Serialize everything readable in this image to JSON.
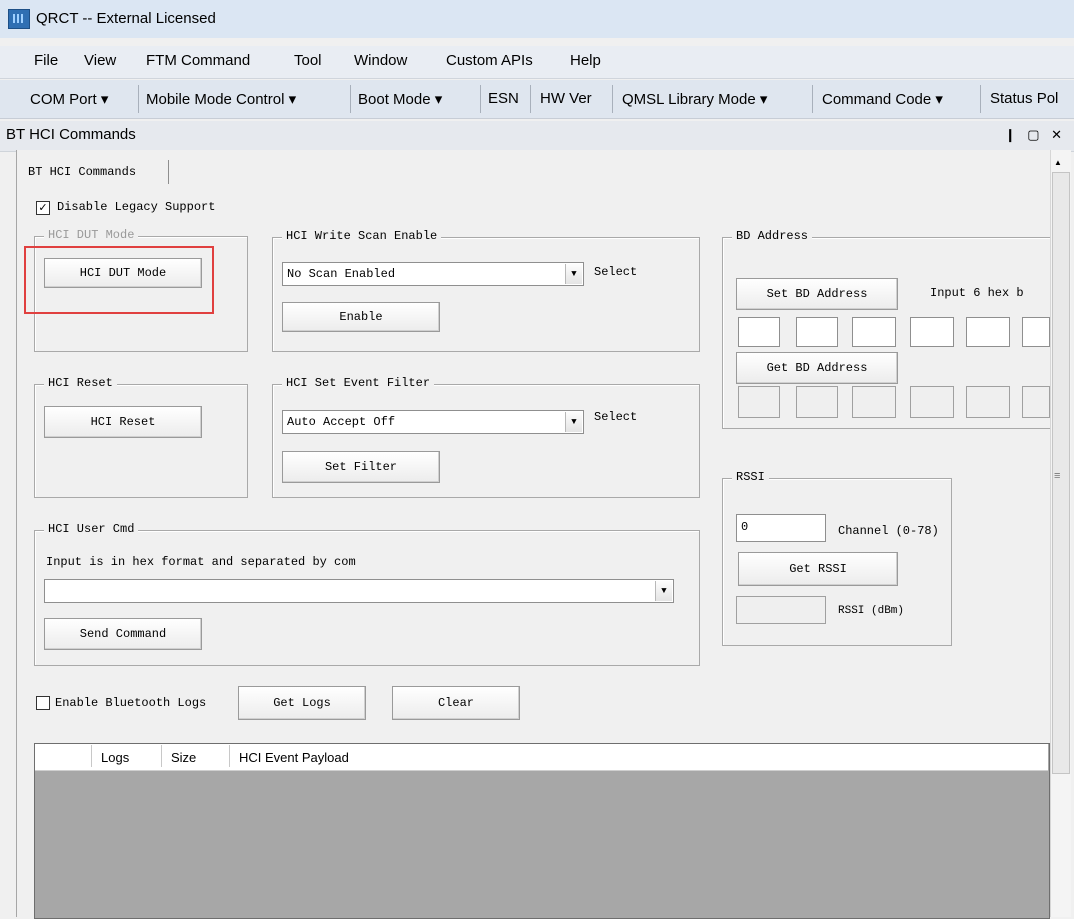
{
  "window": {
    "title": "QRCT -- External Licensed"
  },
  "menu": [
    "File",
    "View",
    "FTM Command",
    "Tool",
    "Window",
    "Custom APIs",
    "Help"
  ],
  "toolbar": [
    "COM Port ▾",
    "Mobile Mode Control ▾",
    "Boot Mode ▾",
    "ESN",
    "HW Ver",
    "QMSL Library Mode ▾",
    "Command Code ▾",
    "Status Pol"
  ],
  "panel": {
    "title": "BT HCI Commands",
    "controls": "❙ ▢ ✕"
  },
  "tab": {
    "label": "BT HCI Commands"
  },
  "legacy": {
    "label": "Disable Legacy Support",
    "checked": true,
    "mark": "✓"
  },
  "dut": {
    "legend": "HCI DUT Mode",
    "button": "HCI DUT Mode"
  },
  "scan": {
    "legend": "HCI Write Scan Enable",
    "value": "No Scan Enabled",
    "select_label": "Select",
    "button": "Enable"
  },
  "bd": {
    "legend": "BD Address",
    "set_button": "Set BD Address",
    "hint": "Input 6  hex b",
    "get_button": "Get BD Address"
  },
  "reset": {
    "legend": "HCI Reset",
    "button": "HCI Reset"
  },
  "filter": {
    "legend": "HCI Set Event Filter",
    "value": "Auto Accept Off",
    "select_label": "Select",
    "button": "Set Filter"
  },
  "rssi": {
    "legend": "RSSI",
    "channel_value": "0",
    "channel_label": "Channel (0-78)",
    "get_button": "Get RSSI",
    "rssi_label": "RSSI (dBm)"
  },
  "usercmd": {
    "legend": "HCI User Cmd",
    "hint": "Input is in hex format and separated by com",
    "value": "",
    "button": "Send Command"
  },
  "logs": {
    "enable_label": "Enable Bluetooth Logs",
    "enabled": false,
    "get_button": "Get Logs",
    "clear_button": "Clear"
  },
  "log_table": {
    "columns": [
      "Logs",
      "Size",
      "HCI Event Payload"
    ]
  },
  "colors": {
    "highlight": "#e0403f",
    "log_bg": "#a7a7a7"
  },
  "icons": {
    "combo_arrow": "chevron-down-icon"
  }
}
